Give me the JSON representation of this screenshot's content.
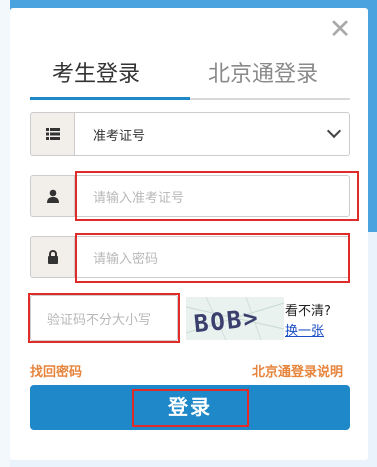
{
  "dialog": {
    "close_icon": "close-icon"
  },
  "tabs": [
    {
      "label": "考生登录",
      "active": true
    },
    {
      "label": "北京通登录",
      "active": false
    }
  ],
  "id_type_select": {
    "value": "准考证号",
    "icon": "list-icon"
  },
  "exam_id_input": {
    "placeholder": "请输入准考证号",
    "icon": "user-icon"
  },
  "password_input": {
    "placeholder": "请输入密码",
    "icon": "lock-icon"
  },
  "captcha": {
    "input_placeholder": "验证码不分大小写",
    "image_text": "BOB>",
    "unclear_label": "看不清?",
    "refresh_link": "换一张"
  },
  "links": {
    "forgot_password": "找回密码",
    "beijingtong_help": "北京通登录说明"
  },
  "login_button": {
    "label": "登录"
  },
  "colors": {
    "accent": "#1e88c9",
    "highlight": "#e02b2b",
    "link": "#e6843c"
  }
}
